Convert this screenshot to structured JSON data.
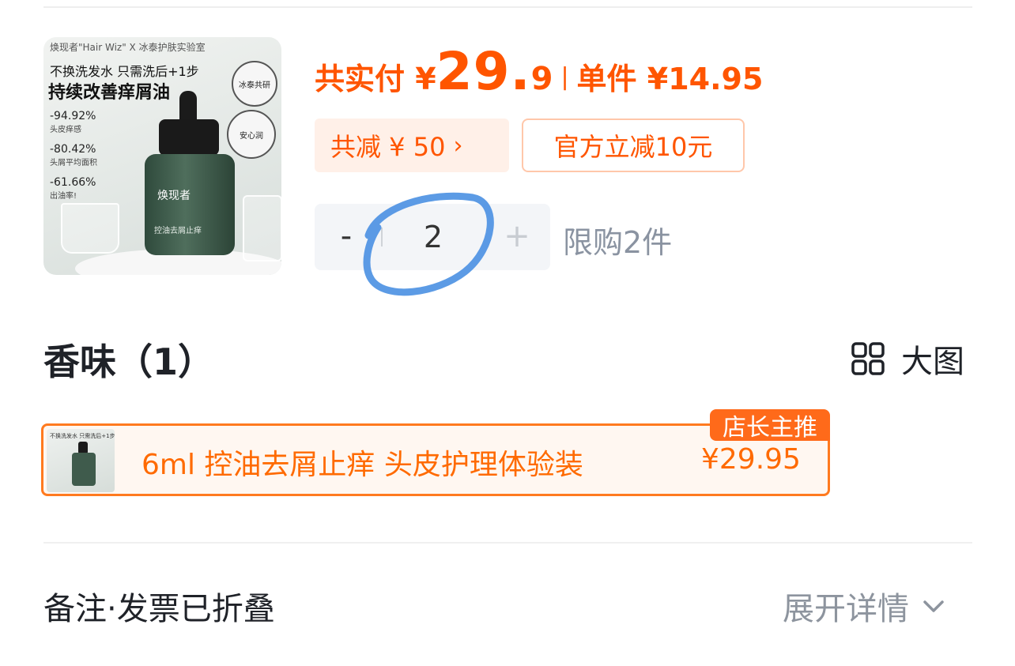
{
  "product_image": {
    "brand_line": "焕现者\"Hair Wiz\" X 冰泰护肤实验室",
    "headline_1": "不换洗发水 只需洗后+1步",
    "headline_2": "持续改善痒屑油",
    "stats": [
      {
        "value": "-94.92%",
        "label": "头皮痒感"
      },
      {
        "value": "-80.42%",
        "label": "头屑平均面积"
      },
      {
        "value": "-61.66%",
        "label": "出油率!"
      }
    ],
    "badge_1": "冰泰共研",
    "badge_2": "安心润",
    "bottle_label": "焕现者",
    "bottle_sublabel": "控油去屑止痒"
  },
  "price": {
    "total_label": "共实付 ¥",
    "total_integer": "29.",
    "total_decimal": "9",
    "separator": "|",
    "unit_label": "单件 ¥14.95"
  },
  "discounts": {
    "total_discount": "共减 ¥ 50",
    "total_discount_chevron": "›",
    "official_discount": "官方立减10元"
  },
  "stepper": {
    "minus": "-",
    "quantity": "2",
    "plus": "+",
    "limit_text": "限购2件"
  },
  "variants": {
    "section_title": "香味（1）",
    "view_toggle_label": "大图",
    "items": [
      {
        "name": "6ml 控油去屑止痒 头皮护理体验装",
        "price": "¥29.95",
        "tag": "店长主推",
        "thumb_text": "不换洗发水 只需洗后+1步"
      }
    ]
  },
  "remarks": {
    "label": "备注·发票已折叠",
    "expand_label": "展开详情"
  },
  "colors": {
    "accent": "#ff5500",
    "tag_bg": "#ff6a1a",
    "muted": "#8a93a1",
    "annotation_circle": "#4a90e2"
  }
}
